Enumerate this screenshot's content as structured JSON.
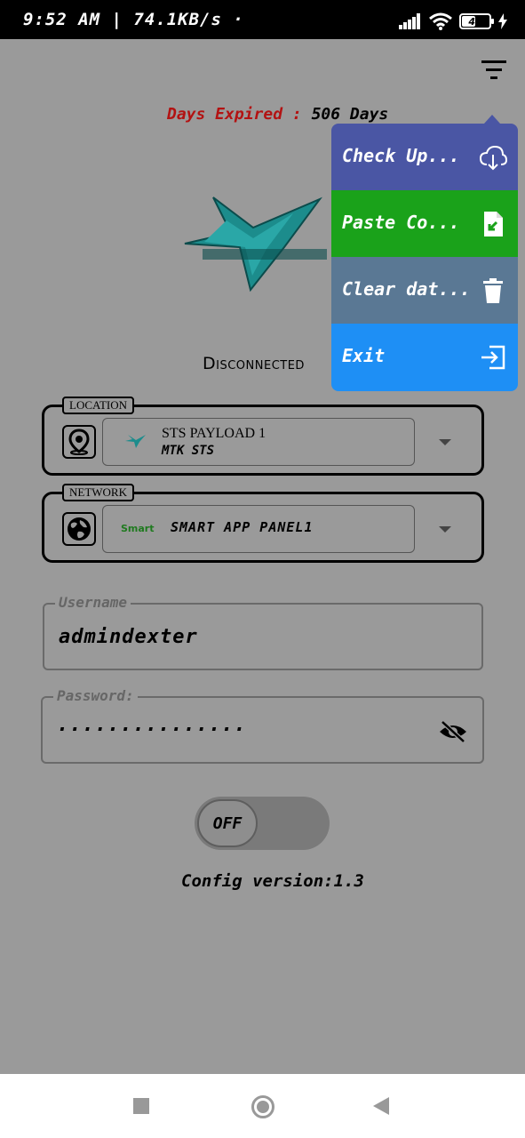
{
  "status_bar": {
    "time": "9:52 AM | 74.1KB/s ·",
    "battery": "46"
  },
  "header": {
    "days_label": "Days Expired :",
    "days_value": "506 Days"
  },
  "connection": {
    "status": "Disconnected"
  },
  "location": {
    "legend": "LOCATION",
    "title": "STS PAYLOAD 1",
    "subtitle": "MTK STS"
  },
  "network": {
    "legend": "NETWORK",
    "brand": "Smart",
    "name": "SMART APP PANEL1"
  },
  "username": {
    "label": "Username",
    "value": "admindexter"
  },
  "password": {
    "label": "Password:",
    "value": "..............."
  },
  "toggle": {
    "label": "OFF"
  },
  "config": {
    "version_text": "Config version:1.3"
  },
  "menu": {
    "items": [
      {
        "label": "Check Up...",
        "icon": "cloud-download-icon",
        "color": "#4a56a4"
      },
      {
        "label": "Paste Co...",
        "icon": "file-import-icon",
        "color": "#1aa21a"
      },
      {
        "label": "Clear dat...",
        "icon": "trash-icon",
        "color": "#5a7894"
      },
      {
        "label": "Exit",
        "icon": "exit-icon",
        "color": "#1e8ff5"
      }
    ]
  }
}
